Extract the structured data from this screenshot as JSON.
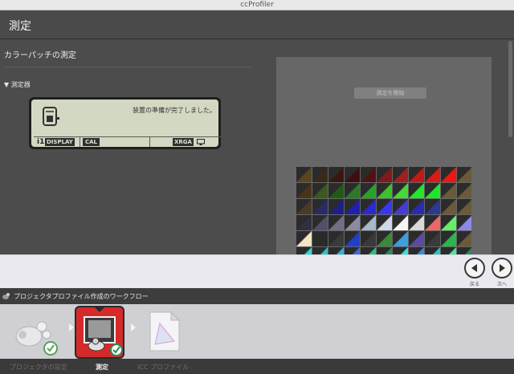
{
  "window": {
    "title": "ccProfiler"
  },
  "header": {
    "title": "測定"
  },
  "left": {
    "section_title": "カラーパッチの測定",
    "device_label": "▼ 測定器",
    "lcd": {
      "message": "装置の準備が完了しました。",
      "badge_i1": "i1",
      "badge_display": "DISPLAY",
      "badge_cal": "CAL",
      "badge_xrga": "XRGA"
    }
  },
  "right": {
    "start_button": "測定を開始"
  },
  "patches": {
    "rows": [
      [
        "#5a4520",
        "#3a2a18",
        "#3b1510",
        "#3e0f12",
        "#501214",
        "#801a1a",
        "#a31e1e",
        "#c21818",
        "#dc1a14",
        "#f31310",
        "#6a5a3a"
      ],
      [
        "#4a3418",
        "#3c5a20",
        "#1f5a18",
        "#2b7a2a",
        "#2aa12a",
        "#3cc22c",
        "#46d83a",
        "#22e82a",
        "#1ee825",
        "#6a5a3a",
        "#6a5a3a"
      ],
      [
        "#4a3a28",
        "#2a2a6a",
        "#1e1e8a",
        "#2020b0",
        "#2a28d0",
        "#3a36ef",
        "#443cd8",
        "#2a2ab0",
        "#2a3a90",
        "#6a5a3a",
        "#6a5a3a"
      ],
      [
        "#303040",
        "#50506a",
        "#707084",
        "#8a8aa0",
        "#a8b8c8",
        "#d0d8e8",
        "#f5f5f5",
        "#d8d8d8",
        "#f06666",
        "#66ee66",
        "#8a8ae8"
      ],
      [
        "#f2e4c4",
        "#2a2a2a",
        "#3a3a3a",
        "#2040c8",
        "#3a3a3a",
        "#3a8a3a",
        "#3aa0e0",
        "#5a4aa0",
        "#3a3a3a",
        "#2ab84a",
        "#6a5a3a"
      ],
      [
        "#2ad8d0",
        "#28c8c0",
        "#28b4e0",
        "#3a6ae0",
        "#28c07a",
        "#2a8a5a",
        "#36e0e0",
        "#3a8adb",
        "#22c8c8",
        "#4ae6a0",
        "#2a8a5a"
      ]
    ]
  },
  "nav": {
    "back_label": "戻る",
    "next_label": "次へ"
  },
  "workflow": {
    "title": "プロジェクタプロファイル作成のワークフロー",
    "steps": [
      {
        "label": "プロジェクタの設定",
        "state": "done"
      },
      {
        "label": "測定",
        "state": "active"
      },
      {
        "label": "ICC プロファイル",
        "state": "pending"
      }
    ]
  }
}
